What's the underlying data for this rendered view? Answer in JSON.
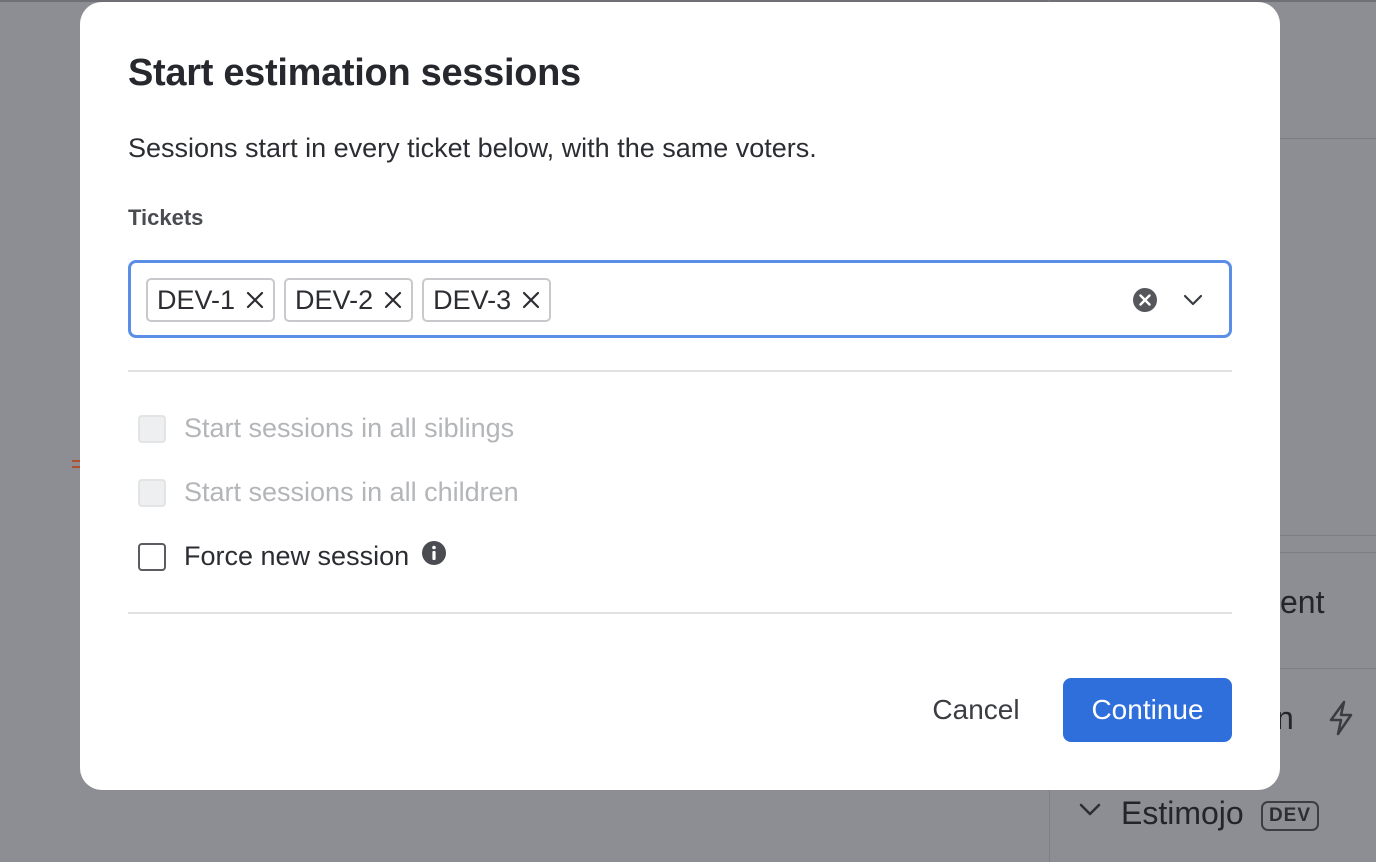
{
  "background": {
    "partial_text_1": "ent",
    "partial_text_2": "n",
    "project_name": "Estimojo",
    "project_badge": "DEV"
  },
  "modal": {
    "title": "Start estimation sessions",
    "description": "Sessions start in every ticket below, with the same voters.",
    "tickets_label": "Tickets",
    "tickets": [
      "DEV-1",
      "DEV-2",
      "DEV-3"
    ],
    "options": [
      {
        "label": "Start sessions in all siblings",
        "checked": false,
        "disabled": true
      },
      {
        "label": "Start sessions in all children",
        "checked": false,
        "disabled": true
      },
      {
        "label": "Force new session",
        "checked": false,
        "disabled": false
      }
    ],
    "cancel_label": "Cancel",
    "continue_label": "Continue"
  },
  "colors": {
    "accent": "#2f6fdb",
    "focus_border": "#5b8ee6",
    "overlay": "#8c8e93"
  },
  "icons": {
    "chip_remove": "close-icon",
    "clear": "clear-circle-icon",
    "dropdown": "chevron-down-icon",
    "info": "info-icon",
    "background_action": "lightning-icon"
  }
}
